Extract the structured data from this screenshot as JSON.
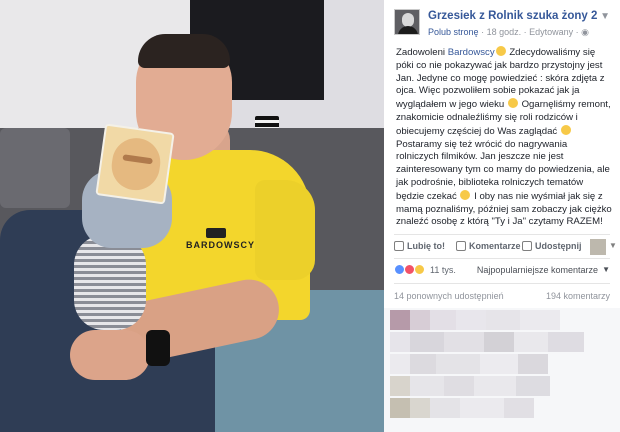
{
  "photo": {
    "shirt_logo_text": "BARDOWSCY"
  },
  "post": {
    "page_name": "Grzesiek z Rolnik szuka żony 2",
    "like_page_label": "Polub stronę",
    "time": "18 godz.",
    "edited": "Edytowany",
    "privacy_icon": "globe-icon",
    "text": {
      "p1": "Zadowoleni ",
      "mention": "Bardowscy",
      "p2": " Zdecydowaliśmy się póki co nie pokazywać jak bardzo przystojny jest Jan. Jedyne co mogę powiedzieć : skóra zdjęta z ojca. Więc pozwoliłem sobie pokazać jak ja wyglądałem w jego wieku ",
      "p3": " Ogarnęliśmy remont, znakomicie odnaleźliśmy się roli rodziców i obiecujemy częściej do Was zaglądać ",
      "p4": " Postaramy się też wrócić do nagrywania rolniczych filmików. Jan jeszcze nie jest zainteresowany tym co mamy do powiedzenia, ale jak podrośnie, biblioteka rolniczych tematów będzie czekać ",
      "p5": " I oby nas nie wyśmiał jak się z mamą poznaliśmy, później sam zobaczy jak ciężko znaleźć osobę z którą \"Ty i Ja\" czytamy RAZEM!"
    }
  },
  "actions": {
    "like": "Lubię to!",
    "comment": "Komentarze",
    "share": "Udostępnij"
  },
  "reactions": {
    "count": "11 tys.",
    "sort_label": "Najpopularniejsze komentarze"
  },
  "stats": {
    "shares": "14 ponownych udostępnień",
    "comments": "194 komentarzy"
  },
  "colors": {
    "link": "#365899",
    "like_reaction": "#5890ff",
    "love_reaction": "#f25268",
    "haha_reaction": "#f7c948"
  }
}
